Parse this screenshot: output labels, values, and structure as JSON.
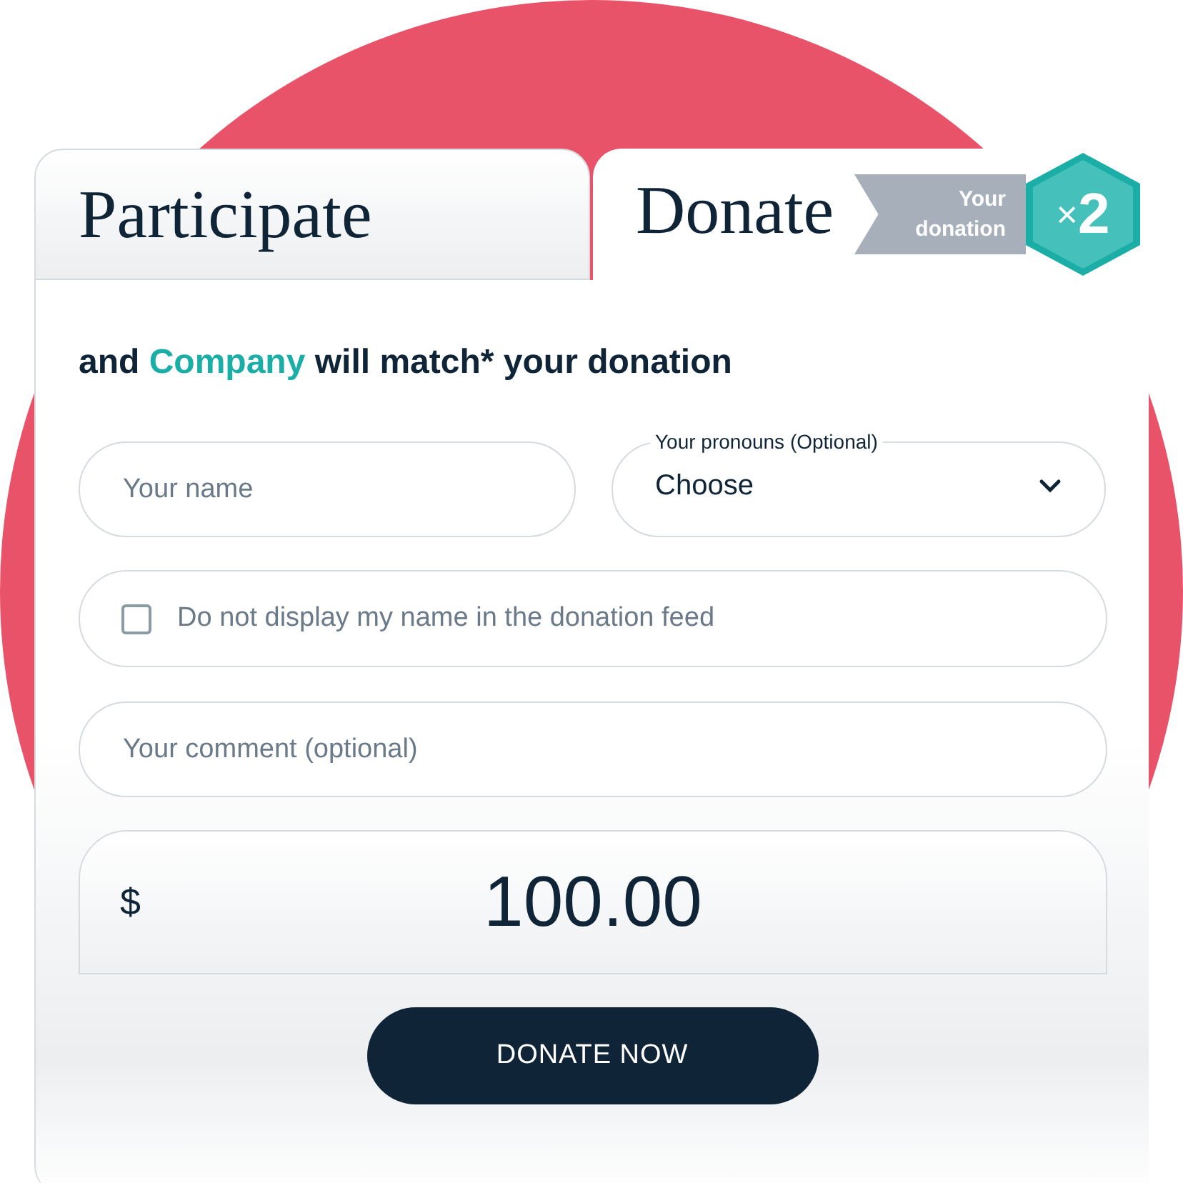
{
  "tabs": [
    {
      "label": "Participate",
      "selected": false
    },
    {
      "label": "Donate",
      "selected": true
    }
  ],
  "badge": {
    "text": "Your donation",
    "sign": "×",
    "multiplier": "2"
  },
  "heading": {
    "before": "and",
    "highlight": "Company",
    "after": "will match* your donation"
  },
  "name_field": {
    "placeholder": "Your name"
  },
  "pronouns": {
    "label": "Your pronouns (Optional)",
    "value": "Choose"
  },
  "hide_name": {
    "label": "Do not display my name in the donation feed",
    "checked": false
  },
  "comment_field": {
    "placeholder": "Your comment (optional)"
  },
  "amount": {
    "currency": "$",
    "value": "100.00"
  },
  "button": "DONATE NOW"
}
